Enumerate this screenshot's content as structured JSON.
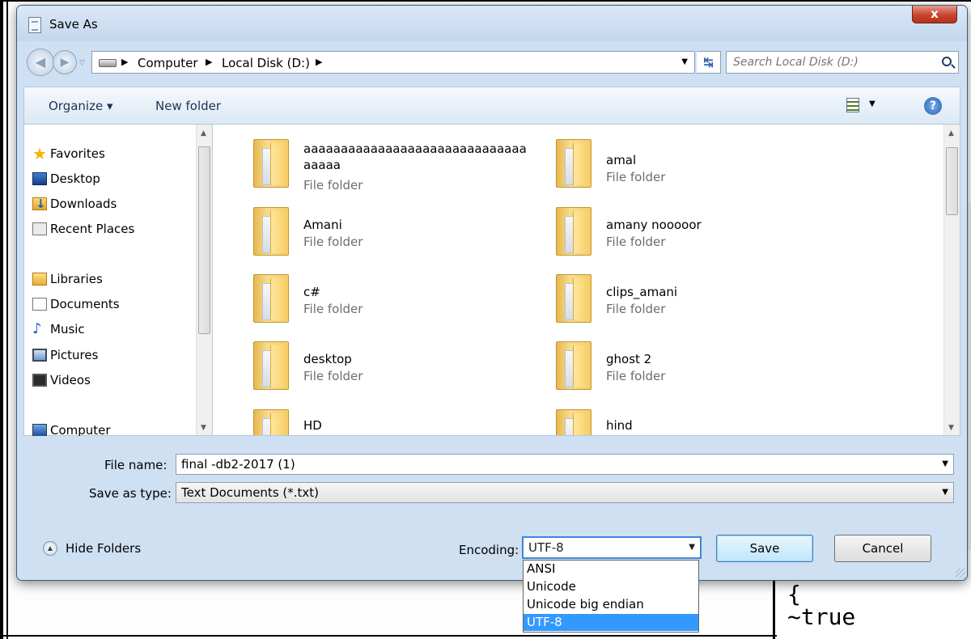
{
  "window": {
    "title": "Save As",
    "close_label": "x"
  },
  "address": {
    "crumbs": [
      "Computer",
      "Local Disk (D:)"
    ],
    "search_placeholder": "Search Local Disk (D:)"
  },
  "commandbar": {
    "organize_label": "Organize ▾",
    "new_folder_label": "New folder"
  },
  "sidebar": {
    "items": [
      {
        "label": "Favorites",
        "icon": "star-icon"
      },
      {
        "label": "Desktop",
        "icon": "desktop-icon"
      },
      {
        "label": "Downloads",
        "icon": "downloads-icon"
      },
      {
        "label": "Recent Places",
        "icon": "recent-places-icon"
      },
      {
        "label": "Libraries",
        "icon": "libraries-icon"
      },
      {
        "label": "Documents",
        "icon": "documents-icon"
      },
      {
        "label": "Music",
        "icon": "music-icon"
      },
      {
        "label": "Pictures",
        "icon": "pictures-icon"
      },
      {
        "label": "Videos",
        "icon": "videos-icon"
      },
      {
        "label": "Computer",
        "icon": "computer-icon"
      }
    ]
  },
  "files": [
    {
      "name": "aaaaaaaaaaaaaaaaaaaaaaaaaaaaaaaaaaa",
      "type": "File folder"
    },
    {
      "name": "amal",
      "type": "File folder"
    },
    {
      "name": "Amani",
      "type": "File folder"
    },
    {
      "name": "amany nooooor",
      "type": "File folder"
    },
    {
      "name": "c#",
      "type": "File folder"
    },
    {
      "name": "clips_amani",
      "type": "File folder"
    },
    {
      "name": "desktop",
      "type": "File folder"
    },
    {
      "name": "ghost 2",
      "type": "File folder"
    },
    {
      "name": "HD",
      "type": ""
    },
    {
      "name": "hind",
      "type": ""
    }
  ],
  "form": {
    "file_name_label": "File name:",
    "file_name_value": "final -db2-2017 (1)",
    "save_type_label": "Save as type:",
    "save_type_value": "Text Documents (*.txt)",
    "hide_folders_label": "Hide Folders",
    "encoding_label": "Encoding:",
    "encoding_value": "UTF-8",
    "encoding_options": [
      "ANSI",
      "Unicode",
      "Unicode big endian",
      "UTF-8"
    ],
    "save_label": "Save",
    "cancel_label": "Cancel"
  },
  "background": {
    "code_lines": [
      "{",
      "~true"
    ]
  }
}
